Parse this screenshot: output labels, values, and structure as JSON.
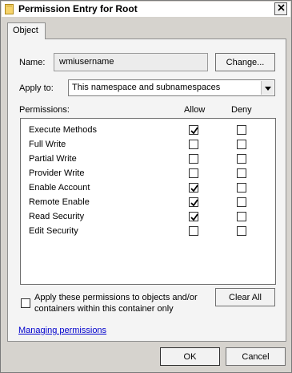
{
  "window": {
    "title": "Permission Entry for Root"
  },
  "tab": {
    "label": "Object"
  },
  "name": {
    "label": "Name:",
    "value": "wmiusername",
    "change_label": "Change..."
  },
  "apply_to": {
    "label": "Apply to:",
    "value": "This namespace and subnamespaces"
  },
  "permissions": {
    "label": "Permissions:",
    "allow_header": "Allow",
    "deny_header": "Deny",
    "rows": [
      {
        "label": "Execute Methods",
        "allow": true,
        "deny": false
      },
      {
        "label": "Full Write",
        "allow": false,
        "deny": false
      },
      {
        "label": "Partial Write",
        "allow": false,
        "deny": false
      },
      {
        "label": "Provider Write",
        "allow": false,
        "deny": false
      },
      {
        "label": "Enable Account",
        "allow": true,
        "deny": false
      },
      {
        "label": "Remote Enable",
        "allow": true,
        "deny": false
      },
      {
        "label": "Read Security",
        "allow": true,
        "deny": false
      },
      {
        "label": "Edit Security",
        "allow": false,
        "deny": false
      }
    ]
  },
  "apply_children": {
    "line1": "Apply these permissions to objects and/or",
    "line2": "containers within this container only",
    "checked": false
  },
  "clear_all_label": "Clear All",
  "managing_link": "Managing permissions",
  "ok_label": "OK",
  "cancel_label": "Cancel"
}
